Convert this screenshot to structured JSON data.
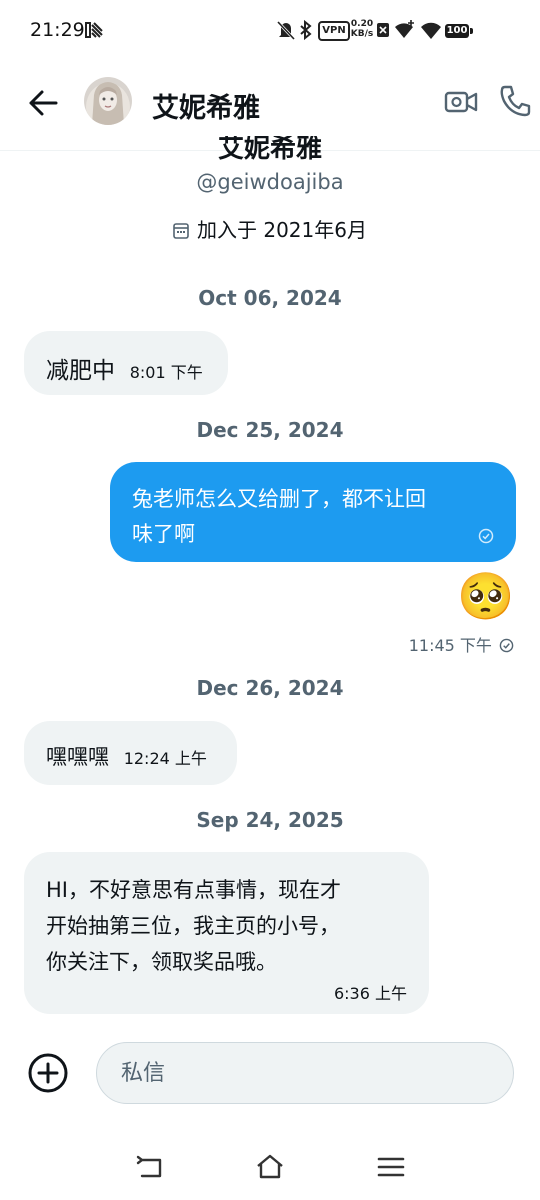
{
  "status": {
    "time": "21:29",
    "vpn": "VPN",
    "net_speed_value": "0.20",
    "net_speed_unit": "KB/s",
    "battery": "100"
  },
  "header": {
    "title": "艾妮希雅"
  },
  "profile": {
    "name": "艾妮希雅",
    "handle": "@geiwdoajiba",
    "joined": "加入于 2021年6月"
  },
  "messages": [
    {
      "date": "Oct 06, 2024",
      "text": "减肥中",
      "time": "8:01 下午"
    },
    {
      "date": "Dec 25, 2024",
      "text_line1": "兔老师怎么又给删了，都不让回",
      "text_line2": "味了啊",
      "emoji": "🥺",
      "time": "11:45 下午"
    },
    {
      "date": "Dec 26, 2024",
      "text": "嘿嘿嘿",
      "time": "12:24 上午"
    },
    {
      "date": "Sep 24, 2025",
      "text_line1": "HI，不好意思有点事情，现在才",
      "text_line2": "开始抽第三位，我主页的小号，",
      "text_line3": "你关注下，领取奖品哦。",
      "time": "6:36 上午"
    }
  ],
  "composer": {
    "placeholder": "私信"
  },
  "colors": {
    "accent": "#1d9bf0",
    "incoming_bubble": "#eff3f4",
    "secondary_text": "#536471"
  }
}
